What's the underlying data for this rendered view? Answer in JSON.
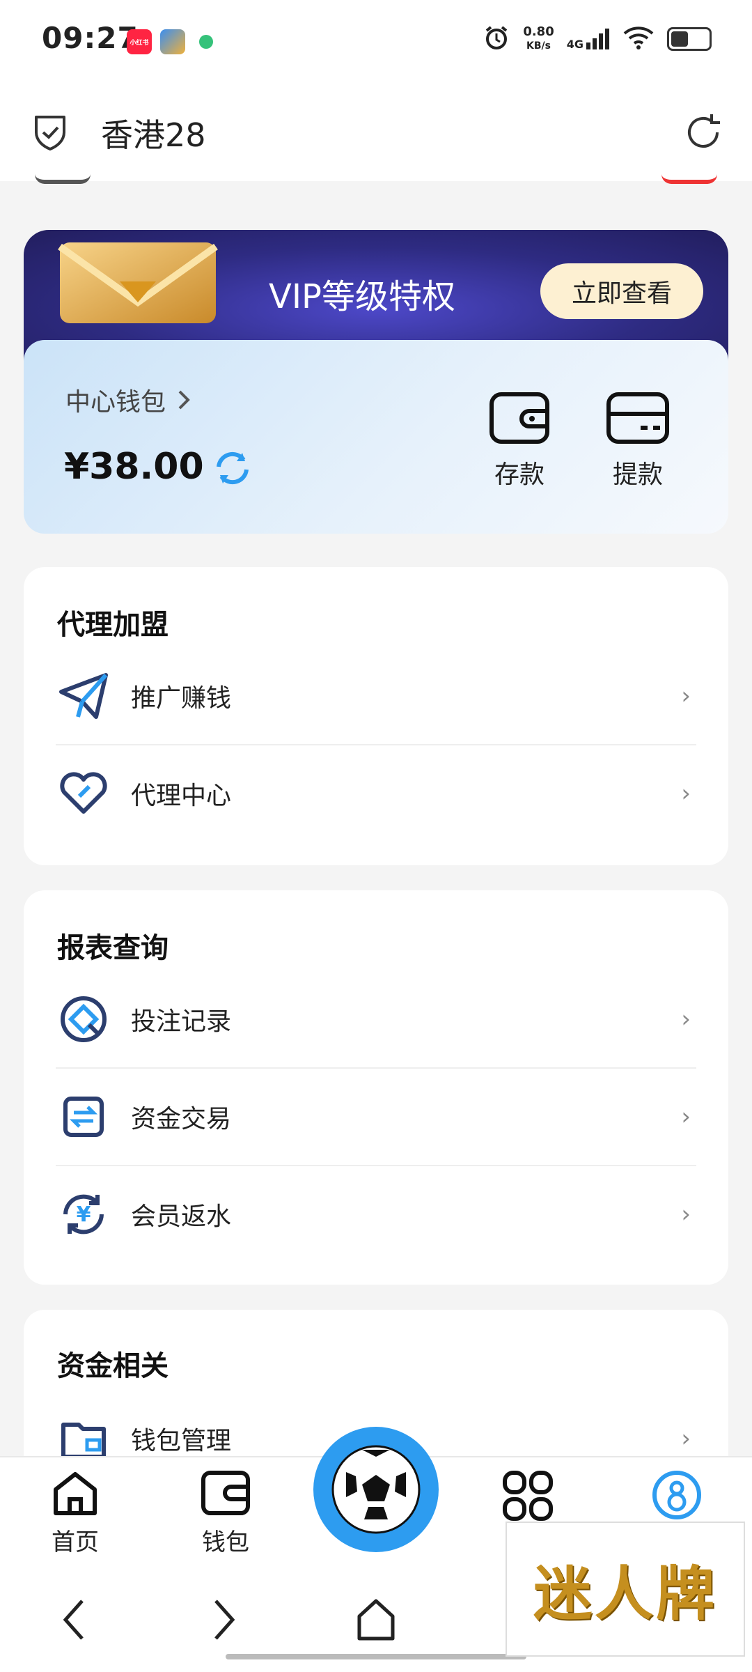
{
  "status_bar": {
    "time": "09:27",
    "apps": [
      {
        "icon": "xiaohongshu-icon",
        "label": "小红书",
        "color": "#ff2442"
      },
      {
        "icon": "app-icon",
        "label": "",
        "color": "#3b8ef0"
      },
      {
        "icon": "leaf-icon",
        "label": "",
        "color": "#35c27a"
      }
    ],
    "speed_value": "0.80",
    "speed_unit": "KB/s",
    "network": "4G"
  },
  "header": {
    "title": "香港28"
  },
  "vip_banner": {
    "text": "VIP等级特权",
    "button_label": "立即查看"
  },
  "wallet": {
    "label": "中心钱包",
    "balance": "¥38.00",
    "deposit_label": "存款",
    "withdraw_label": "提款"
  },
  "sections": {
    "agent": {
      "title": "代理加盟",
      "items": [
        {
          "label": "推广赚钱",
          "icon": "paper-plane-icon"
        },
        {
          "label": "代理中心",
          "icon": "heart-icon"
        }
      ]
    },
    "reports": {
      "title": "报表查询",
      "items": [
        {
          "label": "投注记录",
          "icon": "bet-record-icon"
        },
        {
          "label": "资金交易",
          "icon": "transfer-icon"
        },
        {
          "label": "会员返水",
          "icon": "rebate-icon"
        }
      ]
    },
    "funds": {
      "title": "资金相关",
      "items": [
        {
          "label": "钱包管理",
          "icon": "folder-icon"
        }
      ]
    }
  },
  "tabbar": {
    "home": "首页",
    "wallet": "钱包"
  },
  "watermark": "迷人牌",
  "colors": {
    "accent_blue": "#2d9cf0",
    "vip_purple": "#2e2b82",
    "vip_button": "#fdf0d2"
  }
}
